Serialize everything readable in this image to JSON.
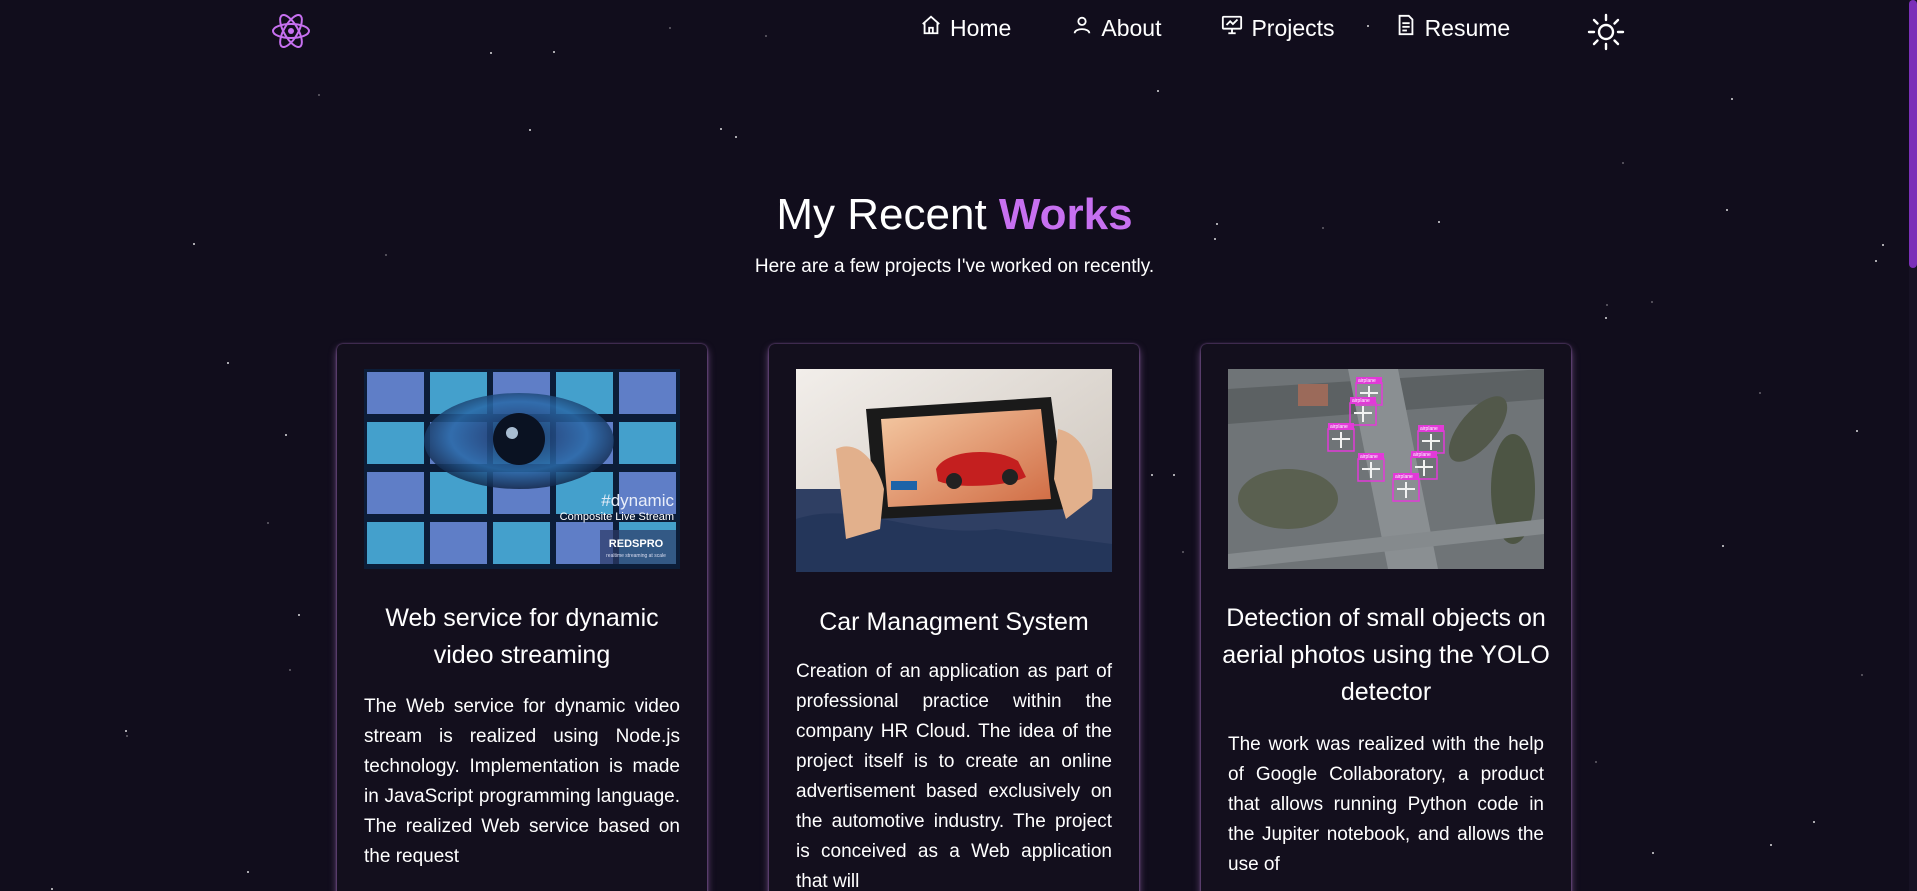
{
  "nav": {
    "logo_icon": "atom-icon",
    "items": [
      {
        "label": "Home",
        "icon": "home-icon"
      },
      {
        "label": "About",
        "icon": "user-icon"
      },
      {
        "label": "Projects",
        "icon": "presentation-icon"
      },
      {
        "label": "Resume",
        "icon": "document-icon"
      }
    ],
    "theme_icon": "sun-icon"
  },
  "heading": {
    "prefix": "My Recent",
    "accent": "Works",
    "subtitle": "Here are a few projects I've worked on recently."
  },
  "colors": {
    "background": "#110d1c",
    "accent": "#c770f0",
    "card_glow": "#c889e6"
  },
  "projects": [
    {
      "title": "Web service for dynamic video streaming",
      "description": "The Web service for dynamic video stream is realized using Node.js technology. Implementation is made in JavaScript programming language. The realized Web service based on the request",
      "image": {
        "tag": "#dynamic",
        "caption": "Composite Live Stream",
        "brand": "REDSPRO",
        "brand_sub": "realtime streaming at scale"
      }
    },
    {
      "title": "Car Managment System",
      "description": "Creation of an application as part of professional practice within the company HR Cloud. The idea of the project itself is to create an online advertisement based exclusively on the automotive industry. The project is conceived as a Web application that will",
      "image": {}
    },
    {
      "title": "Detection of small objects on aerial photos using the YOLO detector",
      "description": "The work was realized with the help of Google Collaboratory, a product that allows running Python code in the Jupiter notebook, and allows the use of",
      "image": {
        "detection_label": "airplane"
      }
    }
  ]
}
